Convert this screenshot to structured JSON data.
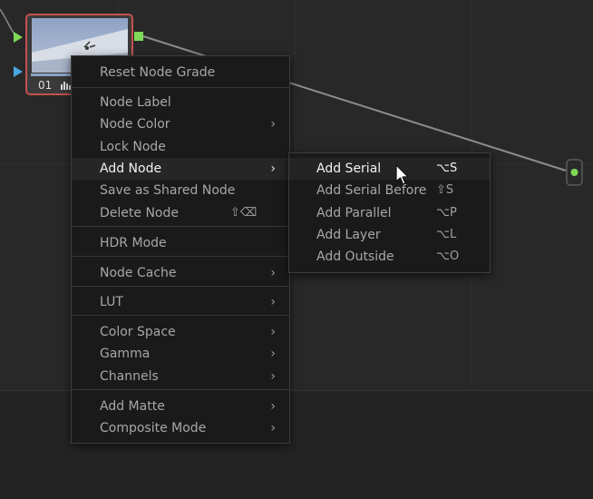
{
  "node": {
    "number": "01"
  },
  "context_menu": {
    "items": [
      {
        "label": "Reset Node Grade",
        "submenu": false,
        "shortcut": ""
      },
      {
        "label": "Node Label",
        "submenu": false,
        "shortcut": ""
      },
      {
        "label": "Node Color",
        "submenu": true,
        "shortcut": ""
      },
      {
        "label": "Lock Node",
        "submenu": false,
        "shortcut": ""
      },
      {
        "label": "Add Node",
        "submenu": true,
        "shortcut": "",
        "active": true
      },
      {
        "label": "Save as Shared Node",
        "submenu": false,
        "shortcut": ""
      },
      {
        "label": "Delete Node",
        "submenu": false,
        "shortcut": "⇧⌫"
      },
      {
        "label": "HDR Mode",
        "submenu": false,
        "shortcut": ""
      },
      {
        "label": "Node Cache",
        "submenu": true,
        "shortcut": ""
      },
      {
        "label": "LUT",
        "submenu": true,
        "shortcut": ""
      },
      {
        "label": "Color Space",
        "submenu": true,
        "shortcut": ""
      },
      {
        "label": "Gamma",
        "submenu": true,
        "shortcut": ""
      },
      {
        "label": "Channels",
        "submenu": true,
        "shortcut": ""
      },
      {
        "label": "Add Matte",
        "submenu": true,
        "shortcut": ""
      },
      {
        "label": "Composite Mode",
        "submenu": true,
        "shortcut": ""
      }
    ]
  },
  "submenu": {
    "items": [
      {
        "label": "Add Serial",
        "shortcut": "⌥S",
        "active": true
      },
      {
        "label": "Add Serial Before",
        "shortcut": "⇧S"
      },
      {
        "label": "Add Parallel",
        "shortcut": "⌥P"
      },
      {
        "label": "Add Layer",
        "shortcut": "⌥L"
      },
      {
        "label": "Add Outside",
        "shortcut": "⌥O"
      }
    ]
  },
  "icons": {
    "submenu_arrow": "chevron-right-icon",
    "histogram": "histogram-icon",
    "cursor": "mouse-pointer-icon",
    "input_port": "triangle-right-icon",
    "output_port": "square-icon"
  },
  "colors": {
    "node_selected_border": "#c4514f",
    "output_port": "#7ed957",
    "input_port_primary": "#7ed957",
    "input_port_secondary": "#4aa8e0"
  }
}
